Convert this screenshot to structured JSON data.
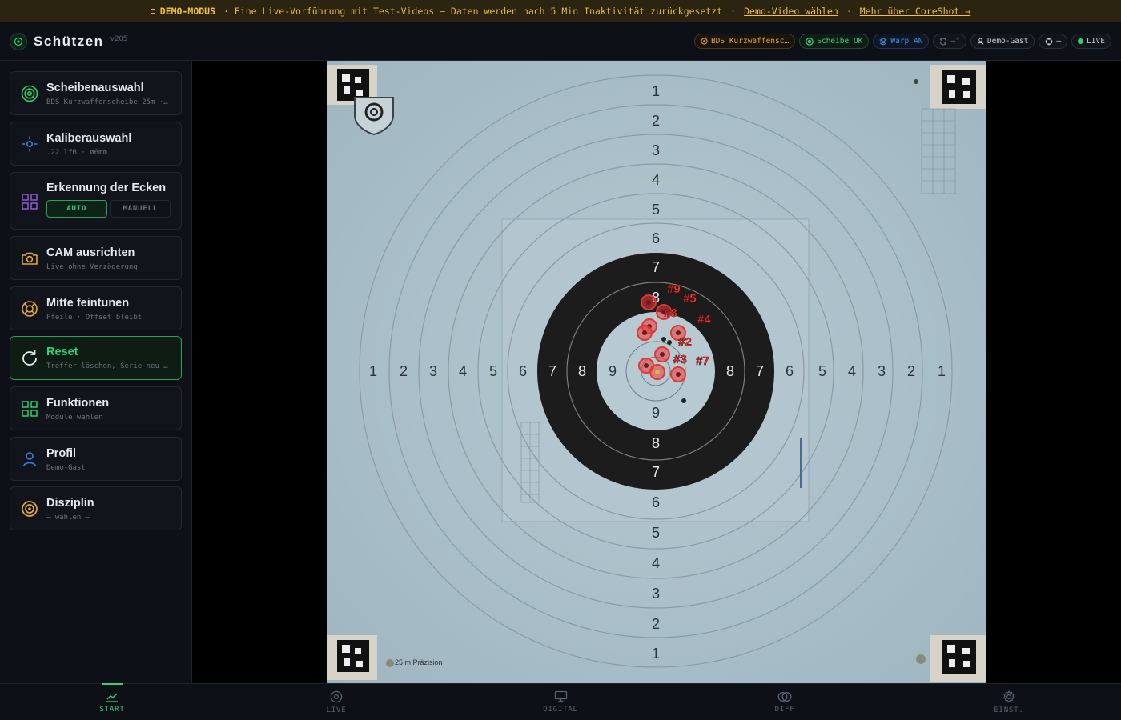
{
  "banner": {
    "badge": "DEMO-MODUS",
    "message": "· Eine Live-Vorführung mit Test-Videos — Daten werden nach 5 Min Inaktivität zurückgesetzt",
    "sep1": "·",
    "sep2": "·",
    "link_video": "Demo-Video wählen",
    "link_about": "Mehr über CoreShot →"
  },
  "header": {
    "title": "Schützen",
    "version": "v205",
    "chips": {
      "target": "BDS Kurzwaffensc…",
      "scheibe": "Scheibe OK",
      "warp": "Warp AN",
      "sync": "—°",
      "user": "Demo-Gast",
      "cross": "—",
      "live": "LIVE"
    }
  },
  "sidebar": {
    "cards": [
      {
        "title": "Scheibenauswahl",
        "sub": "BDS Kurzwaffenscheibe 25m ·…"
      },
      {
        "title": "Kaliberauswahl",
        "sub": ".22 lfB · ø6mm"
      },
      {
        "title": "Erkennung der Ecken",
        "seg_auto": "AUTO",
        "seg_manual": "MANUELL"
      },
      {
        "title": "CAM ausrichten",
        "sub": "Live ohne Verzögerung"
      },
      {
        "title": "Mitte feintunen",
        "sub": "Pfeile · Offset bleibt"
      },
      {
        "title": "Reset",
        "sub": "Treffer löschen, Serie neu …"
      },
      {
        "title": "Funktionen",
        "sub": "Module wählen"
      },
      {
        "title": "Profil",
        "sub": "Demo-Gast"
      },
      {
        "title": "Disziplin",
        "sub": "— wählen —"
      }
    ],
    "icon_colors": {
      "scheibe": "#2fd06c",
      "kaliber": "#3d7fe0",
      "ecken": "#8a5cd6",
      "cam": "#e3a63c",
      "mitte": "#e3a63c",
      "reset": "#e4e9ef",
      "funktionen": "#2fd06c",
      "profil": "#3d7fe0",
      "disziplin": "#e3a63c"
    }
  },
  "target_view": {
    "ring_numbers_vertical_top": [
      "1",
      "2",
      "3",
      "4",
      "5",
      "6",
      "7",
      "8"
    ],
    "ring_numbers_vertical_bottom": [
      "9",
      "8",
      "7",
      "6",
      "5",
      "4",
      "3",
      "2",
      "1"
    ],
    "ring_numbers_horizontal_left": [
      "1",
      "2",
      "3",
      "4",
      "5",
      "6",
      "7",
      "8",
      "9"
    ],
    "ring_numbers_horizontal_right": [
      "8",
      "7",
      "6",
      "5",
      "4",
      "3",
      "2",
      "1"
    ],
    "footer_text": "25 m Präzision",
    "shot_labels": [
      "#9",
      "#5",
      "#8",
      "#4",
      "#2",
      "#7",
      "#3"
    ]
  },
  "bottomnav": {
    "items": [
      {
        "label": "START"
      },
      {
        "label": "LIVE"
      },
      {
        "label": "DIGITAL"
      },
      {
        "label": "DIFF"
      },
      {
        "label": "EINST."
      }
    ]
  }
}
